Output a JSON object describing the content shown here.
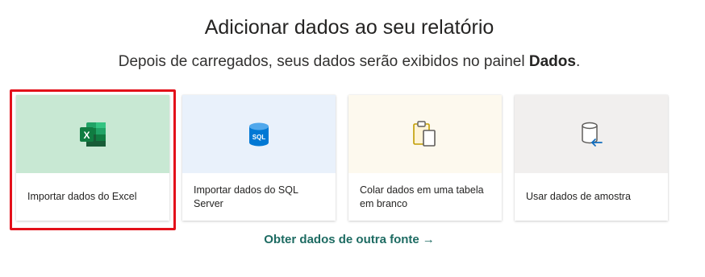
{
  "header": {
    "title": "Adicionar dados ao seu relatório",
    "subtitle_prefix": "Depois de carregados, seus dados serão exibidos no painel ",
    "subtitle_bold": "Dados",
    "subtitle_suffix": "."
  },
  "cards": [
    {
      "label": "Importar dados do Excel",
      "icon": "excel-icon",
      "art_color": "#c8e8d3",
      "highlighted": true
    },
    {
      "label": "Importar dados do SQL Server",
      "icon": "sql-database-icon",
      "art_color": "#e9f1fb",
      "highlighted": false
    },
    {
      "label": "Colar dados em uma tabela em branco",
      "icon": "clipboard-paste-icon",
      "art_color": "#fdf9ee",
      "highlighted": false
    },
    {
      "label": "Usar dados de amostra",
      "icon": "sample-data-icon",
      "art_color": "#f1efee",
      "highlighted": false
    }
  ],
  "footer": {
    "link_label": "Obter dados de outra fonte",
    "link_arrow": "→"
  },
  "colors": {
    "highlight_border": "#e3101a",
    "link": "#1d6b62",
    "excel_green": "#107c41",
    "sql_blue": "#0078d4",
    "clipboard_gold": "#c19c00"
  }
}
